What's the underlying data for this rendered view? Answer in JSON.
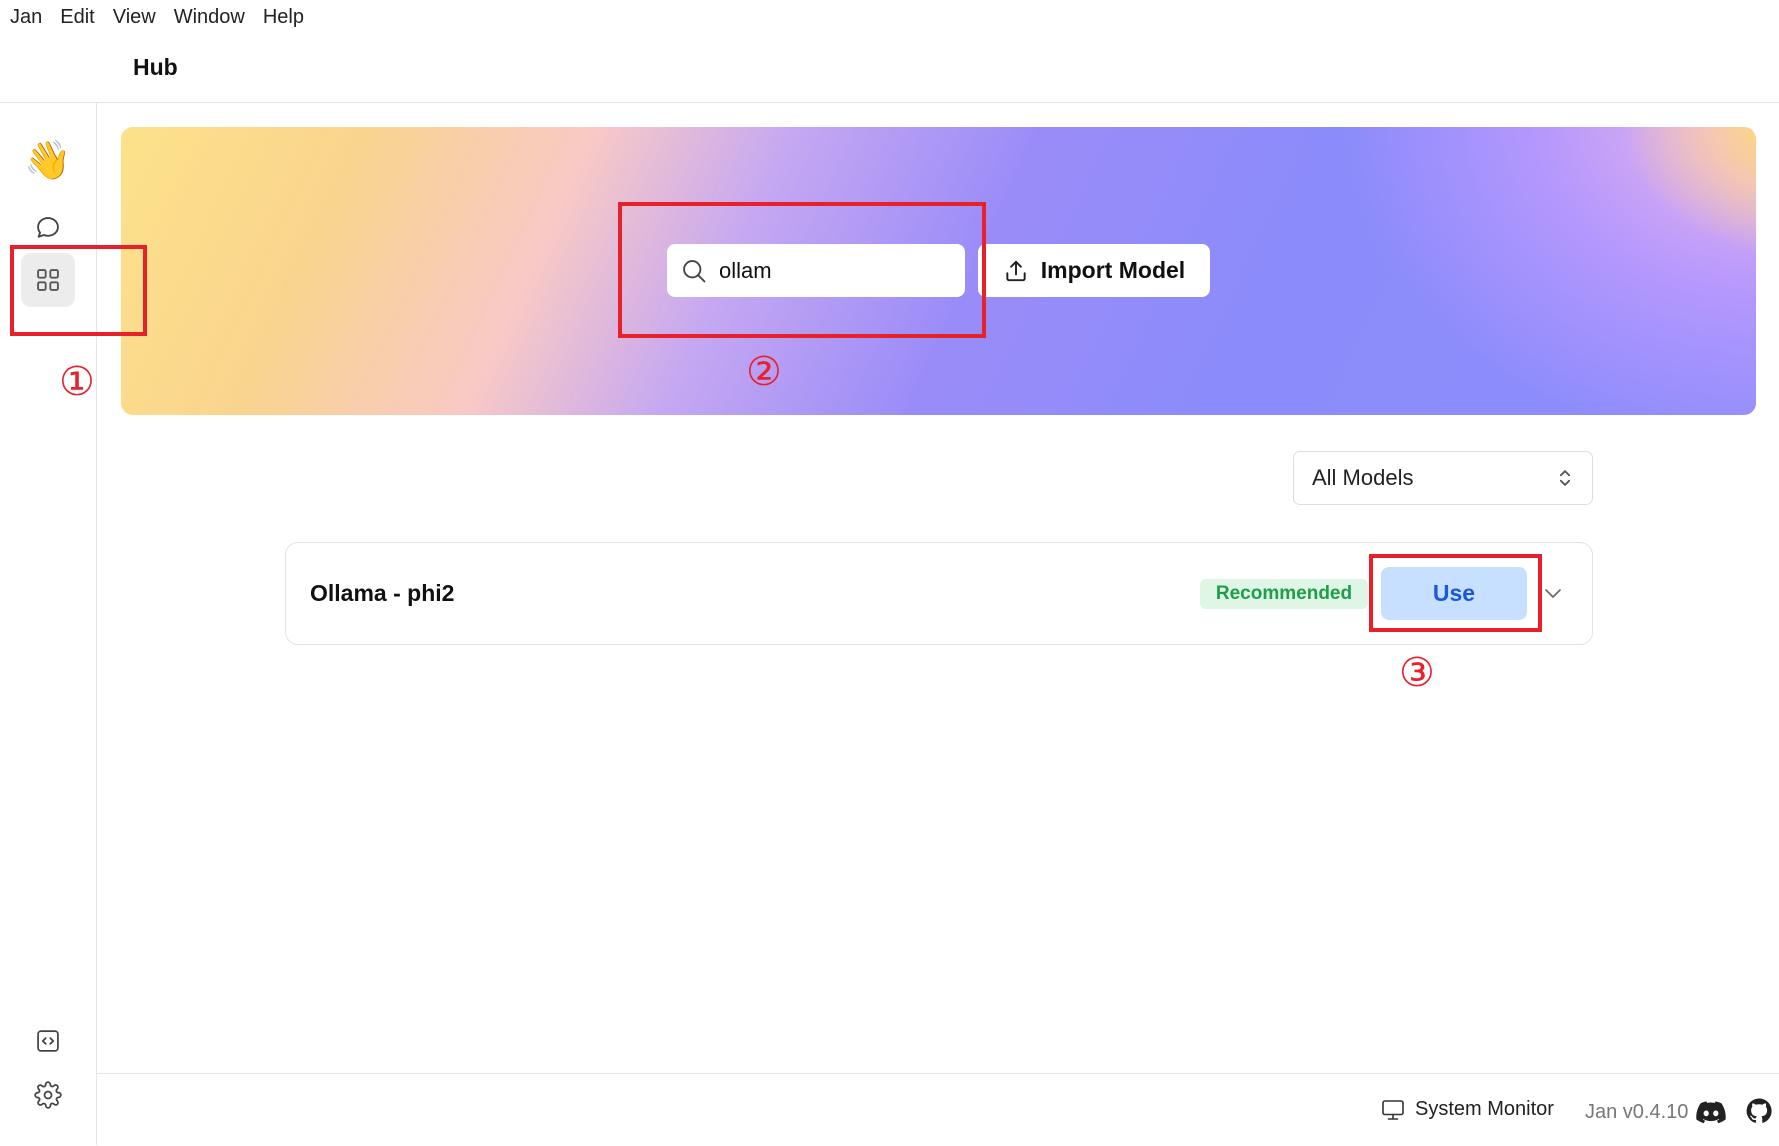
{
  "menubar": {
    "items": [
      "Jan",
      "Edit",
      "View",
      "Window",
      "Help"
    ]
  },
  "header": {
    "title": "Hub"
  },
  "sidebar": {
    "items": [
      {
        "icon": "wave-hand-icon",
        "glyph": "👋"
      },
      {
        "icon": "chat-bubble-icon"
      },
      {
        "icon": "grid-icon",
        "active": true
      },
      {
        "icon": "code-icon"
      },
      {
        "icon": "gear-icon"
      }
    ]
  },
  "hub": {
    "search": {
      "value": "ollam",
      "placeholder": ""
    },
    "import_label": "Import Model",
    "filter": {
      "selected": "All Models"
    }
  },
  "models": [
    {
      "name": "Ollama - phi2",
      "badge": "Recommended",
      "action": "Use"
    }
  ],
  "annotations": {
    "step1": "①",
    "step2": "②",
    "step3": "③",
    "color": "#e8202a"
  },
  "footer": {
    "system_monitor": "System Monitor",
    "version": "Jan v0.4.10"
  },
  "colors": {
    "use_button_bg": "#c8e0ff",
    "use_button_text": "#1d58d6",
    "badge_bg": "#dff5e6",
    "badge_text": "#1e9e4a"
  }
}
